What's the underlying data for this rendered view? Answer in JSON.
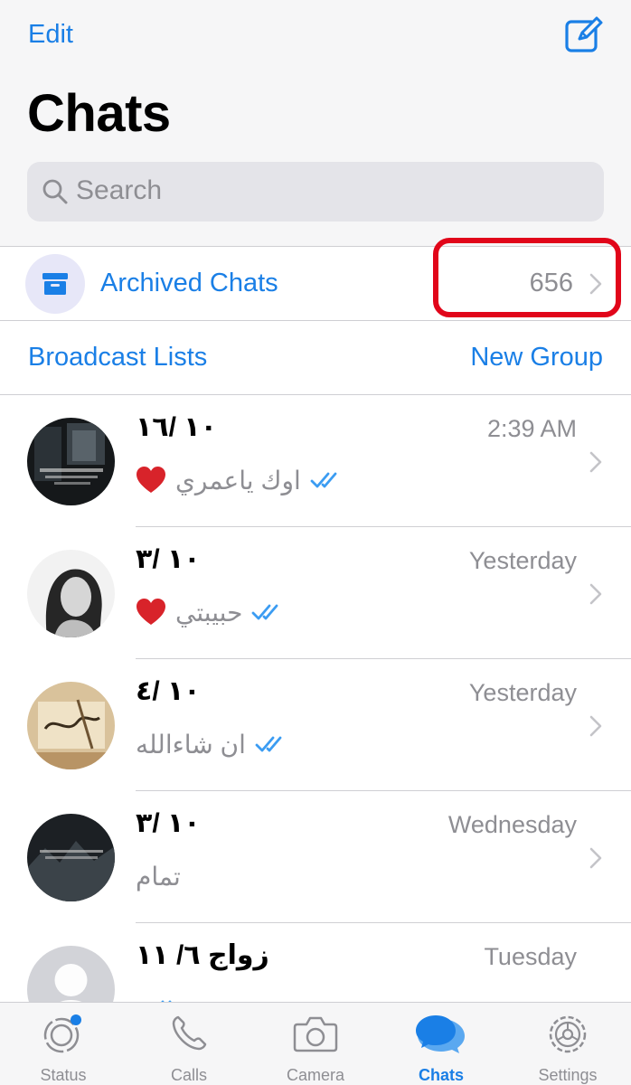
{
  "header": {
    "edit_label": "Edit",
    "title": "Chats",
    "search_placeholder": "Search"
  },
  "archived": {
    "label": "Archived Chats",
    "count": "656"
  },
  "links": {
    "broadcast": "Broadcast Lists",
    "new_group": "New Group"
  },
  "chats": [
    {
      "name": "١٠ /١٦",
      "time": "2:39 AM",
      "message": "اوك ياعمري",
      "heart": true,
      "read": true
    },
    {
      "name": "١٠ /٣",
      "time": "Yesterday",
      "message": "حبيبتي",
      "heart": true,
      "read": true
    },
    {
      "name": "١٠ /٤",
      "time": "Yesterday",
      "message": "ان شاءالله",
      "heart": false,
      "read": true
    },
    {
      "name": "١٠ /٣",
      "time": "Wednesday",
      "message": "تمام",
      "heart": false,
      "read": false
    },
    {
      "name": "زواج ٦/ ١١",
      "time": "Tuesday",
      "message": "",
      "heart": false,
      "read": true
    }
  ],
  "tabs": [
    {
      "label": "Status",
      "icon": "status-icon"
    },
    {
      "label": "Calls",
      "icon": "phone-icon"
    },
    {
      "label": "Camera",
      "icon": "camera-icon"
    },
    {
      "label": "Chats",
      "icon": "chats-icon",
      "active": true
    },
    {
      "label": "Settings",
      "icon": "gear-icon"
    }
  ],
  "colors": {
    "accent": "#1a7fe6",
    "highlight": "#e1061a",
    "secondary_text": "#8e8e93"
  }
}
